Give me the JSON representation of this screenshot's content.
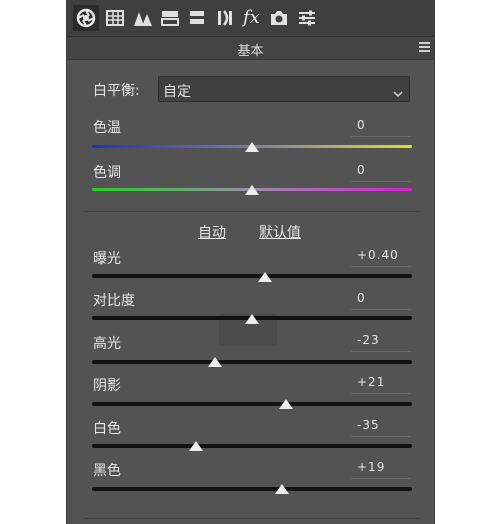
{
  "toolbar": {
    "icons": [
      "aperture-icon",
      "grid-icon",
      "triangles-icon",
      "split-toning-icon",
      "lens-icon",
      "bracket-icon",
      "fx-icon",
      "camera-icon",
      "sliders-icon"
    ],
    "fx_label": "fx"
  },
  "panel": {
    "title": "基本"
  },
  "white_balance": {
    "label": "白平衡:",
    "value": "自定"
  },
  "temperature": {
    "label": "色温",
    "value": "0",
    "level": 0.5
  },
  "tint": {
    "label": "色调",
    "value": "0",
    "level": 0.5
  },
  "tone_links": {
    "auto": "自动",
    "default": "默认值"
  },
  "sliders": [
    {
      "id": "exposure",
      "label": "曝光",
      "value": "+0.40",
      "level": 0.54
    },
    {
      "id": "contrast",
      "label": "对比度",
      "value": "0",
      "level": 0.5
    },
    {
      "id": "highlights",
      "label": "高光",
      "value": "-23",
      "level": 0.385
    },
    {
      "id": "shadows",
      "label": "阴影",
      "value": "+21",
      "level": 0.605
    },
    {
      "id": "whites",
      "label": "白色",
      "value": "-35",
      "level": 0.325
    },
    {
      "id": "blacks",
      "label": "黑色",
      "value": "+19",
      "level": 0.595
    }
  ],
  "colors": {
    "panel_bg": "#535353",
    "toolbar_bg": "#3f3f3f",
    "text": "#e6e6e6"
  }
}
